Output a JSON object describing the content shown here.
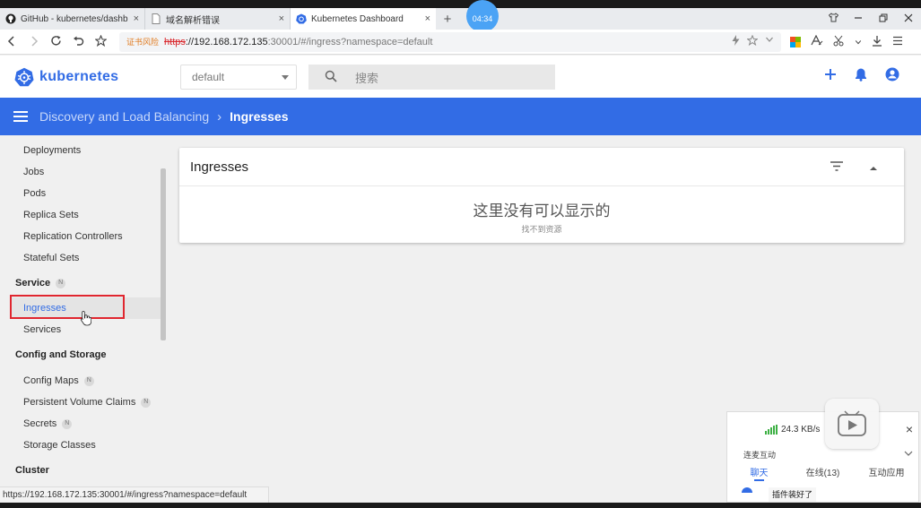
{
  "browser": {
    "tabs": [
      {
        "label": "GitHub - kubernetes/dashb",
        "icon": "github-icon",
        "close": "×"
      },
      {
        "label": "域名解析错误",
        "icon": "page-icon",
        "close": "×"
      },
      {
        "label": "Kubernetes Dashboard",
        "icon": "k8s-icon",
        "close": "×",
        "active": true
      }
    ],
    "new_tab": "+",
    "clock": "04:34",
    "address": {
      "cert_warning": "证书风险",
      "scheme": "https",
      "host": "://192.168.172.135",
      "rest": ":30001/#/ingress?namespace=default"
    },
    "status_url": "https://192.168.172.135:30001/#/ingress?namespace=default"
  },
  "app": {
    "brand": "kubernetes",
    "namespace": "default",
    "search_placeholder": "搜索",
    "accent": "#326ce5"
  },
  "breadcrumb": {
    "parent": "Discovery and Load Balancing",
    "separator": "›",
    "current": "Ingresses"
  },
  "sidebar": {
    "items": [
      {
        "label": "Deployments",
        "type": "item"
      },
      {
        "label": "Jobs",
        "type": "item"
      },
      {
        "label": "Pods",
        "type": "item"
      },
      {
        "label": "Replica Sets",
        "type": "item"
      },
      {
        "label": "Replication Controllers",
        "type": "item"
      },
      {
        "label": "Stateful Sets",
        "type": "item"
      },
      {
        "label": "Service",
        "type": "section",
        "badge": "N"
      },
      {
        "label": "Ingresses",
        "type": "item",
        "selected": true
      },
      {
        "label": "Services",
        "type": "item"
      },
      {
        "label": "Config and Storage",
        "type": "section"
      },
      {
        "label": "Config Maps",
        "type": "item",
        "badge": "N"
      },
      {
        "label": "Persistent Volume Claims",
        "type": "item",
        "badge": "N"
      },
      {
        "label": "Secrets",
        "type": "item",
        "badge": "N"
      },
      {
        "label": "Storage Classes",
        "type": "item"
      },
      {
        "label": "Cluster",
        "type": "section"
      }
    ]
  },
  "card": {
    "title": "Ingresses",
    "empty_title": "这里没有可以显示的",
    "empty_subtitle": "找不到资源"
  },
  "float_panel": {
    "speed": "24.3 KB/s",
    "subtitle": "连麦互动",
    "tabs": [
      "聊天",
      "在线(13)",
      "互动应用"
    ],
    "toast": "插件装好了",
    "close": "×"
  }
}
